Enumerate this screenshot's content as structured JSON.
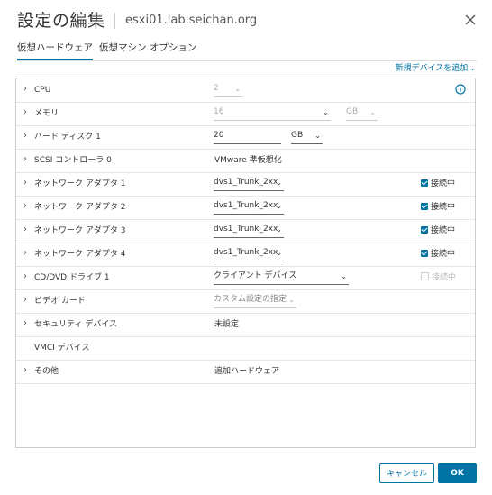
{
  "dialog": {
    "title": "設定の編集",
    "subtitle": "esxi01.lab.seichan.org"
  },
  "tabs": [
    {
      "label": "仮想ハードウェア",
      "active": true
    },
    {
      "label": "仮想マシン オプション",
      "active": false
    }
  ],
  "add_device_label": "新規デバイスを追加",
  "hardware": {
    "cpu": {
      "label": "CPU",
      "value": "2"
    },
    "memory": {
      "label": "メモリ",
      "value": "16",
      "unit": "GB"
    },
    "hard_disk": {
      "label": "ハード ディスク 1",
      "value": "20",
      "unit": "GB"
    },
    "scsi": {
      "label": "SCSI コントローラ 0",
      "value": "VMware 準仮想化"
    },
    "nic1": {
      "label": "ネットワーク アダプタ 1",
      "value": "dvs1_Trunk_2xx",
      "status": "接続中"
    },
    "nic2": {
      "label": "ネットワーク アダプタ 2",
      "value": "dvs1_Trunk_2xx",
      "status": "接続中"
    },
    "nic3": {
      "label": "ネットワーク アダプタ 3",
      "value": "dvs1_Trunk_2xx",
      "status": "接続中"
    },
    "nic4": {
      "label": "ネットワーク アダプタ 4",
      "value": "dvs1_Trunk_2xx",
      "status": "接続中"
    },
    "cdrom": {
      "label": "CD/DVD ドライブ 1",
      "value": "クライアント デバイス",
      "status": "接続中"
    },
    "video": {
      "label": "ビデオ カード",
      "value": "カスタム設定の指定"
    },
    "security": {
      "label": "セキュリティ デバイス",
      "value": "未設定"
    },
    "vmci": {
      "label": "VMCI デバイス"
    },
    "other": {
      "label": "その他",
      "value": "追加ハードウェア"
    }
  },
  "buttons": {
    "cancel": "キャンセル",
    "ok": "OK"
  },
  "colors": {
    "accent": "#0072a3",
    "border": "#cccccc"
  }
}
